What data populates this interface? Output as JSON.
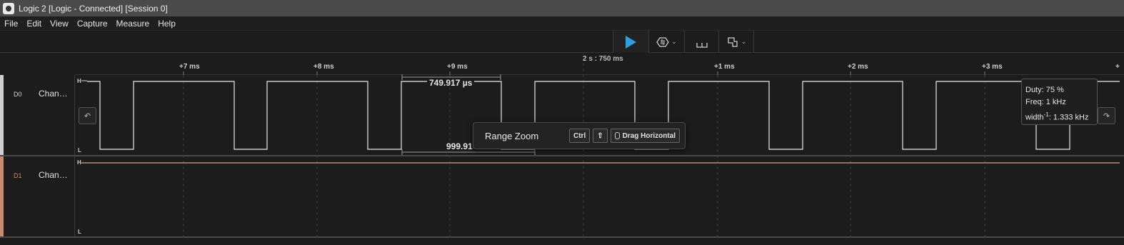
{
  "window": {
    "title": "Logic 2 [Logic - Connected] [Session 0]"
  },
  "menu": [
    "File",
    "Edit",
    "View",
    "Capture",
    "Measure",
    "Help"
  ],
  "toolbar": {
    "play_icon": "play-icon",
    "trigger_icon": "trigger-icon",
    "markers_count": "3",
    "layout_icon": "layout-icon"
  },
  "ruler": {
    "center_time": "2 s : 750 ms",
    "ticks": [
      "+7 ms",
      "+8 ms",
      "+9 ms",
      "+1 ms",
      "+2 ms",
      "+3 ms",
      "+"
    ]
  },
  "channels": [
    {
      "num": "D0",
      "name": "Chan…",
      "color": "#d8d8d8",
      "high": "H",
      "low": "L"
    },
    {
      "num": "D1",
      "name": "Chan…",
      "color": "#d98a5f",
      "high": "H",
      "low": "L"
    }
  ],
  "measurements": {
    "width_label": "749.917 µs",
    "period_label": "999.91"
  },
  "range_zoom": {
    "title": "Range Zoom",
    "key_ctrl": "Ctrl",
    "key_shift": "⇧",
    "drag": "Drag Horizontal"
  },
  "measure_box": {
    "duty": "Duty: 75 %",
    "freq": "Freq: 1 kHz",
    "width_prefix": "width",
    "width_sup": "-1",
    "width_suffix": ": 1.333 kHz"
  },
  "colors": {
    "accent": "#2e9fe0",
    "d0_stripe": "#cfcfcf",
    "d1_stripe": "#c98a6d",
    "d1_line": "#e0a27e"
  }
}
